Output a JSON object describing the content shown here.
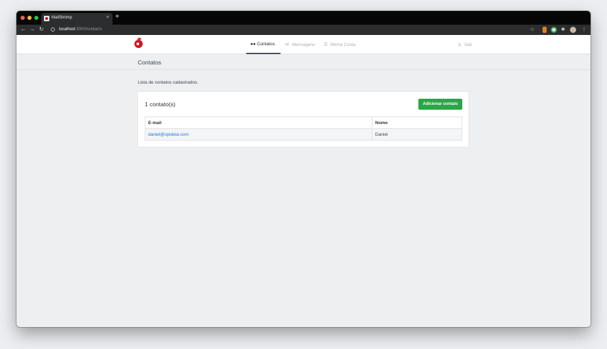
{
  "browser": {
    "tab_title": "MailShrimp",
    "tab_close": "×",
    "new_tab": "+",
    "url_host": "localhost",
    "url_rest": ":3000/contacts",
    "traffic_colors": [
      "#ff5f56",
      "#ffbd2e",
      "#27c93f"
    ]
  },
  "nav": {
    "items": [
      {
        "label": "Contatos",
        "icon": "users-icon",
        "active": true
      },
      {
        "label": "Mensagens",
        "icon": "envelope-icon",
        "active": false
      },
      {
        "label": "Minha Conta",
        "icon": "list-icon",
        "active": false
      }
    ],
    "logout_label": "Sair"
  },
  "page": {
    "title": "Contatos",
    "description": "Lista de contatos cadastrados."
  },
  "card": {
    "count_text": "1 contato(s)",
    "add_button": "Adicionar contato"
  },
  "table": {
    "headers": [
      "E-mail",
      "Nome"
    ],
    "rows": [
      {
        "email": "daniel@opideia.com",
        "name": "Daniel"
      }
    ]
  },
  "colors": {
    "accent_green": "#28a745",
    "link_blue": "#1a73e8",
    "brand_red": "#d3141c"
  }
}
